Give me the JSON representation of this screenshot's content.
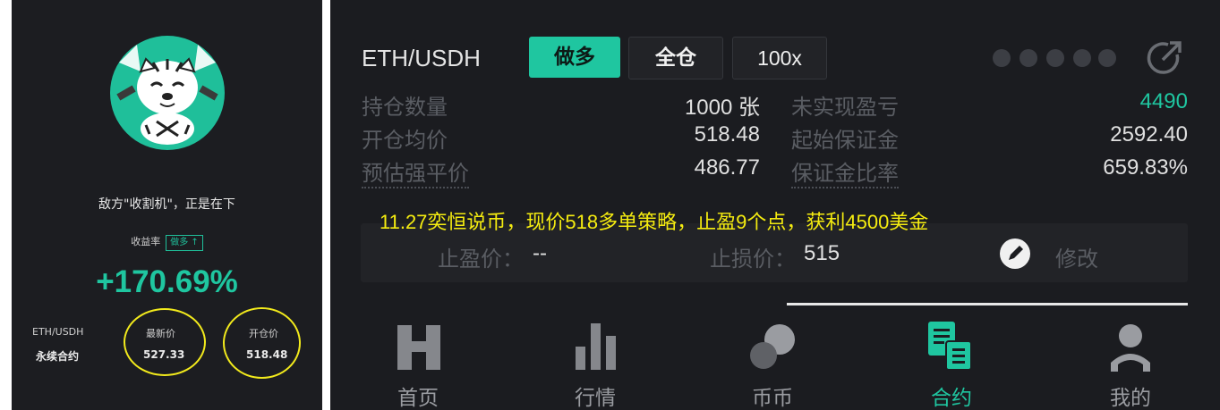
{
  "share_card": {
    "headline": "敌方\"收割机\"，正是在下",
    "yield_label": "收益率",
    "direction_badge": "做多 ↑",
    "yield_value": "+170.69%",
    "pair": "ETH/USDH",
    "contract_type": "永续合约",
    "latest_price_label": "最新价",
    "latest_price": "527.33",
    "open_price_label": "开仓价",
    "open_price": "518.48"
  },
  "position": {
    "pair": "ETH/USDH",
    "direction": "做多",
    "margin_mode": "全仓",
    "leverage": "100x",
    "rows": [
      {
        "left_label": "持仓数量",
        "left_value": "1000 张",
        "right_label": "未实现盈亏",
        "right_value": "4490"
      },
      {
        "left_label": "开仓均价",
        "left_value": "518.48",
        "right_label": "起始保证金",
        "right_value": "2592.40"
      },
      {
        "left_label": "预估强平价",
        "left_value": "486.77",
        "right_label": "保证金比率",
        "right_value": "659.83%"
      }
    ],
    "take_profit_label": "止盈价：",
    "take_profit_value": "--",
    "stop_loss_label": "止损价：",
    "stop_loss_value": "515",
    "modify_label": "修改"
  },
  "caption": "11.27奕恒说币，现价518多单策略，止盈9个点，获利4500美金",
  "nav": [
    {
      "label": "首页",
      "icon": "home-h-icon"
    },
    {
      "label": "行情",
      "icon": "bar-chart-icon"
    },
    {
      "label": "币币",
      "icon": "coins-icon"
    },
    {
      "label": "合约",
      "icon": "contract-doc-icon"
    },
    {
      "label": "我的",
      "icon": "user-icon"
    }
  ],
  "colors": {
    "accent_green": "#1fc6a0",
    "annotation_yellow": "#f2ea1c",
    "background": "#1b1c20"
  }
}
